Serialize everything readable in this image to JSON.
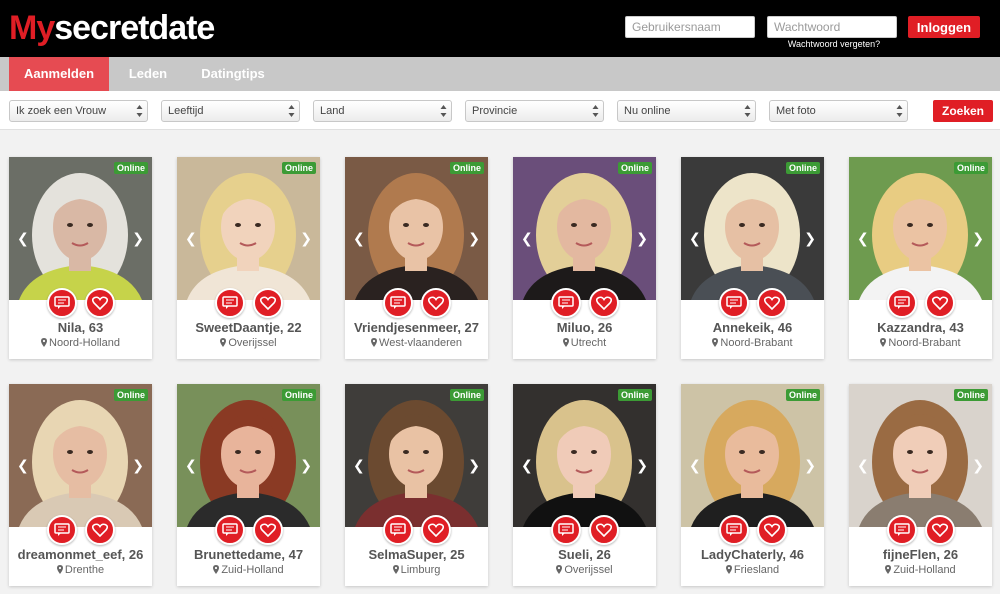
{
  "header": {
    "logo_my": "My",
    "logo_rest": "secretdate",
    "username_placeholder": "Gebruikersnaam",
    "password_placeholder": "Wachtwoord",
    "login_label": "Inloggen",
    "forgot_label": "Wachtwoord vergeten?"
  },
  "nav": {
    "items": [
      {
        "label": "Aanmelden",
        "active": true
      },
      {
        "label": "Leden",
        "active": false
      },
      {
        "label": "Datingtips",
        "active": false
      }
    ]
  },
  "filters": {
    "selects": [
      "Ik zoek een Vrouw",
      "Leeftijd",
      "Land",
      "Provincie",
      "Nu online",
      "Met foto"
    ],
    "search_label": "Zoeken"
  },
  "profiles": [
    {
      "name": "Nila, 63",
      "location": "Noord-Holland",
      "status": "Online",
      "bg": "#6b6e66",
      "hair": "#e4e2dc",
      "skin": "#d9b8a5",
      "top": "#c6d34a"
    },
    {
      "name": "SweetDaantje, 22",
      "location": "Overijssel",
      "status": "Online",
      "bg": "#c9b89a",
      "hair": "#e6d08d",
      "skin": "#f1d3bc",
      "top": "#f0e5d6"
    },
    {
      "name": "Vriendjesenmeer, 27",
      "location": "West-vlaanderen",
      "status": "Online",
      "bg": "#7a5a45",
      "hair": "#b07a4e",
      "skin": "#e9c3a6",
      "top": "#2a2220"
    },
    {
      "name": "Miluo, 26",
      "location": "Utrecht",
      "status": "Online",
      "bg": "#6a4e7a",
      "hair": "#e3cf98",
      "skin": "#e3b8a0",
      "top": "#1d1a1a"
    },
    {
      "name": "Annekeik, 46",
      "location": "Noord-Brabant",
      "status": "Online",
      "bg": "#3a3a3a",
      "hair": "#ede4c9",
      "skin": "#e6c0a4",
      "top": "#4a4f55"
    },
    {
      "name": "Kazzandra, 43",
      "location": "Noord-Brabant",
      "status": "Online",
      "bg": "#6e9b4f",
      "hair": "#e8cc82",
      "skin": "#ebc3a3",
      "top": "#f3f3f3"
    },
    {
      "name": "dreamonmet_eef, 26",
      "location": "Drenthe",
      "status": "Online",
      "bg": "#8a6a55",
      "hair": "#e8d6b3",
      "skin": "#e6bda3",
      "top": "#d9c9b4"
    },
    {
      "name": "Brunettedame, 47",
      "location": "Zuid-Holland",
      "status": "Online",
      "bg": "#78905a",
      "hair": "#8a3a24",
      "skin": "#e8b49b",
      "top": "#2b2b2b"
    },
    {
      "name": "SelmaSuper, 25",
      "location": "Limburg",
      "status": "Online",
      "bg": "#3f3d3a",
      "hair": "#6b4a30",
      "skin": "#e9c2a4",
      "top": "#7a2f2f"
    },
    {
      "name": "Sueli, 26",
      "location": "Overijssel",
      "status": "Online",
      "bg": "#33302e",
      "hair": "#d9c28c",
      "skin": "#f0cbb8",
      "top": "#111111"
    },
    {
      "name": "LadyChaterly, 46",
      "location": "Friesland",
      "status": "Online",
      "bg": "#cdc3a6",
      "hair": "#d7a95e",
      "skin": "#e9bb9c",
      "top": "#1f1f1f"
    },
    {
      "name": "fijneFlen, 26",
      "location": "Zuid-Holland",
      "status": "Online",
      "bg": "#d9d3cc",
      "hair": "#9a6b43",
      "skin": "#f0cdb8",
      "top": "#8a7d70"
    }
  ],
  "colors": {
    "accent": "#e01e25",
    "online": "#3c9b35"
  },
  "icons": {
    "message": "message-icon",
    "favorite": "heart-icon",
    "location": "location-pin-icon"
  }
}
